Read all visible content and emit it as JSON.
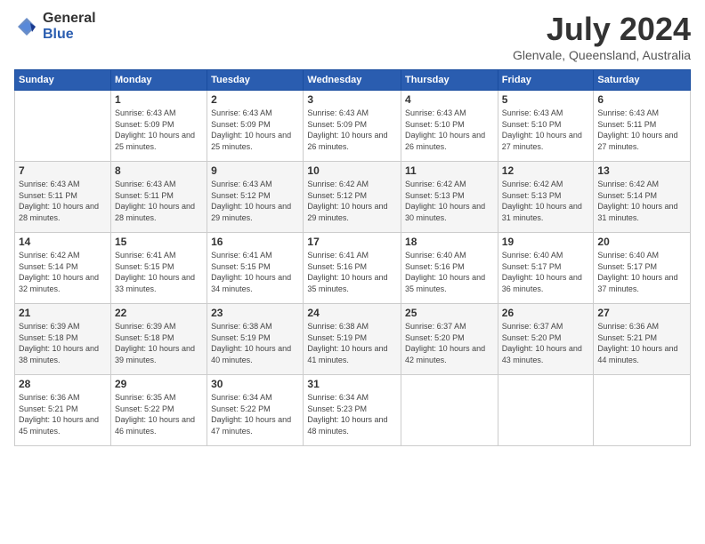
{
  "logo": {
    "general": "General",
    "blue": "Blue"
  },
  "title": {
    "month_year": "July 2024",
    "location": "Glenvale, Queensland, Australia"
  },
  "headers": [
    "Sunday",
    "Monday",
    "Tuesday",
    "Wednesday",
    "Thursday",
    "Friday",
    "Saturday"
  ],
  "weeks": [
    [
      {
        "day": "",
        "sunrise": "",
        "sunset": "",
        "daylight": ""
      },
      {
        "day": "1",
        "sunrise": "Sunrise: 6:43 AM",
        "sunset": "Sunset: 5:09 PM",
        "daylight": "Daylight: 10 hours and 25 minutes."
      },
      {
        "day": "2",
        "sunrise": "Sunrise: 6:43 AM",
        "sunset": "Sunset: 5:09 PM",
        "daylight": "Daylight: 10 hours and 25 minutes."
      },
      {
        "day": "3",
        "sunrise": "Sunrise: 6:43 AM",
        "sunset": "Sunset: 5:09 PM",
        "daylight": "Daylight: 10 hours and 26 minutes."
      },
      {
        "day": "4",
        "sunrise": "Sunrise: 6:43 AM",
        "sunset": "Sunset: 5:10 PM",
        "daylight": "Daylight: 10 hours and 26 minutes."
      },
      {
        "day": "5",
        "sunrise": "Sunrise: 6:43 AM",
        "sunset": "Sunset: 5:10 PM",
        "daylight": "Daylight: 10 hours and 27 minutes."
      },
      {
        "day": "6",
        "sunrise": "Sunrise: 6:43 AM",
        "sunset": "Sunset: 5:11 PM",
        "daylight": "Daylight: 10 hours and 27 minutes."
      }
    ],
    [
      {
        "day": "7",
        "sunrise": "Sunrise: 6:43 AM",
        "sunset": "Sunset: 5:11 PM",
        "daylight": "Daylight: 10 hours and 28 minutes."
      },
      {
        "day": "8",
        "sunrise": "Sunrise: 6:43 AM",
        "sunset": "Sunset: 5:11 PM",
        "daylight": "Daylight: 10 hours and 28 minutes."
      },
      {
        "day": "9",
        "sunrise": "Sunrise: 6:43 AM",
        "sunset": "Sunset: 5:12 PM",
        "daylight": "Daylight: 10 hours and 29 minutes."
      },
      {
        "day": "10",
        "sunrise": "Sunrise: 6:42 AM",
        "sunset": "Sunset: 5:12 PM",
        "daylight": "Daylight: 10 hours and 29 minutes."
      },
      {
        "day": "11",
        "sunrise": "Sunrise: 6:42 AM",
        "sunset": "Sunset: 5:13 PM",
        "daylight": "Daylight: 10 hours and 30 minutes."
      },
      {
        "day": "12",
        "sunrise": "Sunrise: 6:42 AM",
        "sunset": "Sunset: 5:13 PM",
        "daylight": "Daylight: 10 hours and 31 minutes."
      },
      {
        "day": "13",
        "sunrise": "Sunrise: 6:42 AM",
        "sunset": "Sunset: 5:14 PM",
        "daylight": "Daylight: 10 hours and 31 minutes."
      }
    ],
    [
      {
        "day": "14",
        "sunrise": "Sunrise: 6:42 AM",
        "sunset": "Sunset: 5:14 PM",
        "daylight": "Daylight: 10 hours and 32 minutes."
      },
      {
        "day": "15",
        "sunrise": "Sunrise: 6:41 AM",
        "sunset": "Sunset: 5:15 PM",
        "daylight": "Daylight: 10 hours and 33 minutes."
      },
      {
        "day": "16",
        "sunrise": "Sunrise: 6:41 AM",
        "sunset": "Sunset: 5:15 PM",
        "daylight": "Daylight: 10 hours and 34 minutes."
      },
      {
        "day": "17",
        "sunrise": "Sunrise: 6:41 AM",
        "sunset": "Sunset: 5:16 PM",
        "daylight": "Daylight: 10 hours and 35 minutes."
      },
      {
        "day": "18",
        "sunrise": "Sunrise: 6:40 AM",
        "sunset": "Sunset: 5:16 PM",
        "daylight": "Daylight: 10 hours and 35 minutes."
      },
      {
        "day": "19",
        "sunrise": "Sunrise: 6:40 AM",
        "sunset": "Sunset: 5:17 PM",
        "daylight": "Daylight: 10 hours and 36 minutes."
      },
      {
        "day": "20",
        "sunrise": "Sunrise: 6:40 AM",
        "sunset": "Sunset: 5:17 PM",
        "daylight": "Daylight: 10 hours and 37 minutes."
      }
    ],
    [
      {
        "day": "21",
        "sunrise": "Sunrise: 6:39 AM",
        "sunset": "Sunset: 5:18 PM",
        "daylight": "Daylight: 10 hours and 38 minutes."
      },
      {
        "day": "22",
        "sunrise": "Sunrise: 6:39 AM",
        "sunset": "Sunset: 5:18 PM",
        "daylight": "Daylight: 10 hours and 39 minutes."
      },
      {
        "day": "23",
        "sunrise": "Sunrise: 6:38 AM",
        "sunset": "Sunset: 5:19 PM",
        "daylight": "Daylight: 10 hours and 40 minutes."
      },
      {
        "day": "24",
        "sunrise": "Sunrise: 6:38 AM",
        "sunset": "Sunset: 5:19 PM",
        "daylight": "Daylight: 10 hours and 41 minutes."
      },
      {
        "day": "25",
        "sunrise": "Sunrise: 6:37 AM",
        "sunset": "Sunset: 5:20 PM",
        "daylight": "Daylight: 10 hours and 42 minutes."
      },
      {
        "day": "26",
        "sunrise": "Sunrise: 6:37 AM",
        "sunset": "Sunset: 5:20 PM",
        "daylight": "Daylight: 10 hours and 43 minutes."
      },
      {
        "day": "27",
        "sunrise": "Sunrise: 6:36 AM",
        "sunset": "Sunset: 5:21 PM",
        "daylight": "Daylight: 10 hours and 44 minutes."
      }
    ],
    [
      {
        "day": "28",
        "sunrise": "Sunrise: 6:36 AM",
        "sunset": "Sunset: 5:21 PM",
        "daylight": "Daylight: 10 hours and 45 minutes."
      },
      {
        "day": "29",
        "sunrise": "Sunrise: 6:35 AM",
        "sunset": "Sunset: 5:22 PM",
        "daylight": "Daylight: 10 hours and 46 minutes."
      },
      {
        "day": "30",
        "sunrise": "Sunrise: 6:34 AM",
        "sunset": "Sunset: 5:22 PM",
        "daylight": "Daylight: 10 hours and 47 minutes."
      },
      {
        "day": "31",
        "sunrise": "Sunrise: 6:34 AM",
        "sunset": "Sunset: 5:23 PM",
        "daylight": "Daylight: 10 hours and 48 minutes."
      },
      {
        "day": "",
        "sunrise": "",
        "sunset": "",
        "daylight": ""
      },
      {
        "day": "",
        "sunrise": "",
        "sunset": "",
        "daylight": ""
      },
      {
        "day": "",
        "sunrise": "",
        "sunset": "",
        "daylight": ""
      }
    ]
  ]
}
